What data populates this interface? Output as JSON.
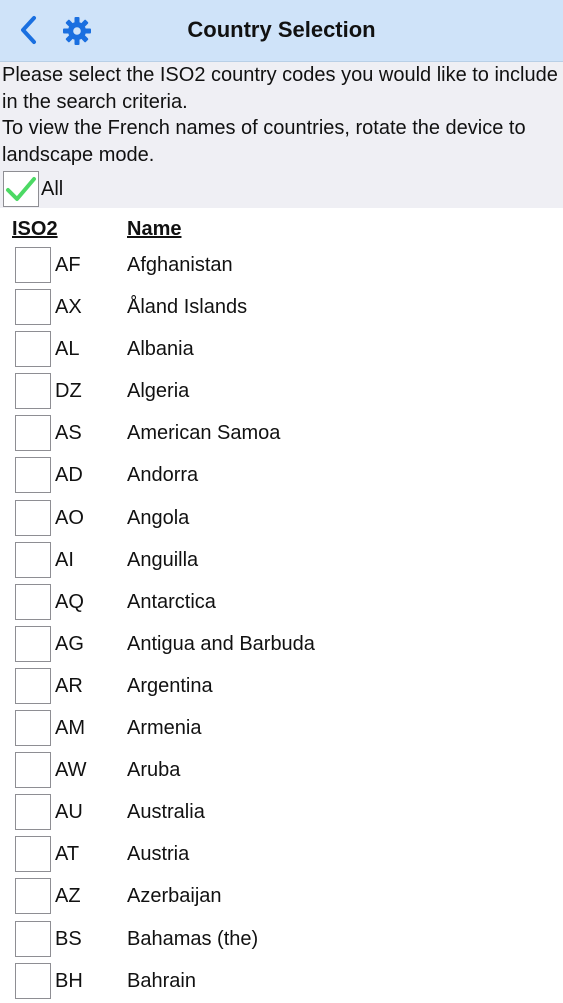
{
  "nav": {
    "title": "Country Selection",
    "back_icon": "chevron-left-icon",
    "settings_icon": "gear-icon",
    "accent_color": "#1a6fe0"
  },
  "intro": {
    "line1": "Please select the ISO2 country codes you would like to include in the search criteria.",
    "line2": "To view the French names of countries, rotate the device to landscape mode."
  },
  "all_toggle": {
    "label": "All",
    "checked": true,
    "check_color": "#4cd964"
  },
  "table": {
    "header_iso": "ISO2",
    "header_name": "Name",
    "rows": [
      {
        "code": "AF",
        "name": "Afghanistan",
        "checked": false
      },
      {
        "code": "AX",
        "name": "Åland Islands",
        "checked": false
      },
      {
        "code": "AL",
        "name": "Albania",
        "checked": false
      },
      {
        "code": "DZ",
        "name": "Algeria",
        "checked": false
      },
      {
        "code": "AS",
        "name": "American Samoa",
        "checked": false
      },
      {
        "code": "AD",
        "name": "Andorra",
        "checked": false
      },
      {
        "code": "AO",
        "name": "Angola",
        "checked": false
      },
      {
        "code": "AI",
        "name": "Anguilla",
        "checked": false
      },
      {
        "code": "AQ",
        "name": "Antarctica",
        "checked": false
      },
      {
        "code": "AG",
        "name": "Antigua and Barbuda",
        "checked": false
      },
      {
        "code": "AR",
        "name": "Argentina",
        "checked": false
      },
      {
        "code": "AM",
        "name": "Armenia",
        "checked": false
      },
      {
        "code": "AW",
        "name": "Aruba",
        "checked": false
      },
      {
        "code": "AU",
        "name": "Australia",
        "checked": false
      },
      {
        "code": "AT",
        "name": "Austria",
        "checked": false
      },
      {
        "code": "AZ",
        "name": "Azerbaijan",
        "checked": false
      },
      {
        "code": "BS",
        "name": "Bahamas (the)",
        "checked": false
      },
      {
        "code": "BH",
        "name": "Bahrain",
        "checked": false
      }
    ]
  }
}
